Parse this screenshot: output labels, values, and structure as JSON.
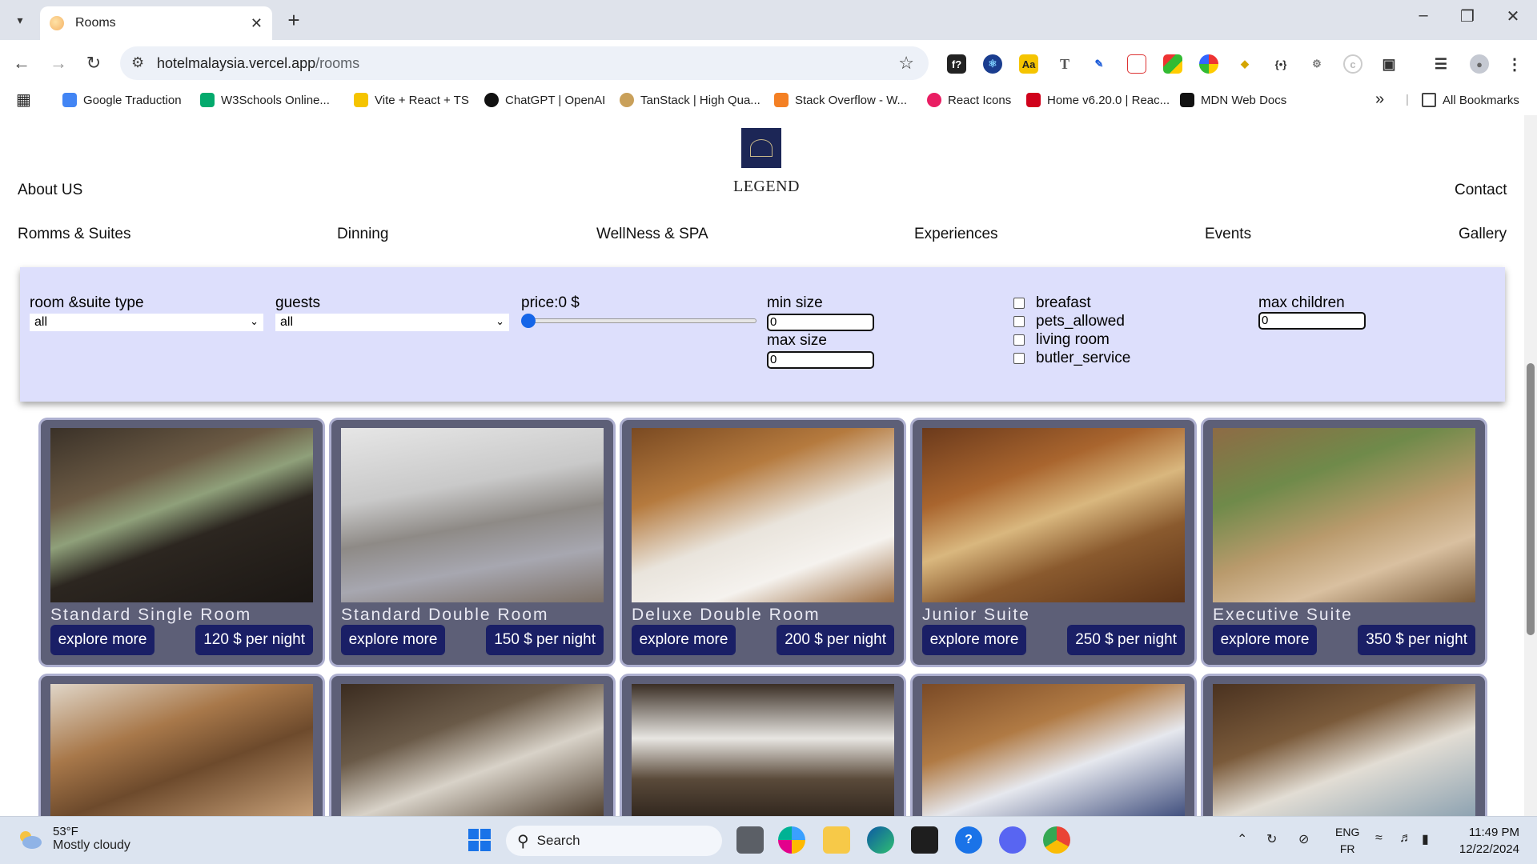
{
  "browser": {
    "tab_title": "Rooms",
    "url_host": "hotelmalaysia.vercel.app",
    "url_path": "/rooms",
    "bookmarks": [
      "Google Traduction",
      "W3Schools Online...",
      "Vite + React + TS",
      "ChatGPT | OpenAI",
      "TanStack | High Qua...",
      "Stack Overflow - W...",
      "React Icons",
      "Home v6.20.0 | Reac...",
      "MDN Web Docs"
    ],
    "all_bookmarks": "All Bookmarks",
    "extension_labels": {
      "f": "f?",
      "aa": "Aa",
      "t": "T"
    }
  },
  "site": {
    "brand": "LEGEND",
    "top_left_link": "About US",
    "top_right_link": "Contact",
    "nav": [
      "Romms & Suites",
      "Dinning",
      "WellNess & SPA",
      "Experiences",
      "Events",
      "Gallery"
    ]
  },
  "filters": {
    "room_type_label": "room &suite type",
    "room_type_value": "all",
    "guests_label": "guests",
    "guests_value": "all",
    "price_label": "price:0 $",
    "price_fraction": 0,
    "min_size_label": "min size",
    "min_size_value": "0",
    "max_size_label": "max size",
    "max_size_value": "0",
    "checkboxes": [
      "breafast",
      "pets_allowed",
      "living room",
      "butler_service"
    ],
    "max_children_label": "max children",
    "max_children_value": "0"
  },
  "rooms": [
    {
      "name": "Standard Single Room",
      "explore": "explore more",
      "price": "120 $ per night"
    },
    {
      "name": "Standard Double Room",
      "explore": "explore more",
      "price": "150 $ per night"
    },
    {
      "name": "Deluxe Double Room",
      "explore": "explore more",
      "price": "200 $ per night"
    },
    {
      "name": "Junior Suite",
      "explore": "explore more",
      "price": "250 $ per night"
    },
    {
      "name": "Executive Suite",
      "explore": "explore more",
      "price": "350 $ per night"
    }
  ],
  "taskbar": {
    "temperature": "53°F",
    "weather": "Mostly cloudy",
    "search_label": "Search",
    "lang_1": "ENG",
    "lang_2": "FR",
    "time": "11:49 PM",
    "date": "12/22/2024"
  },
  "colors": {
    "filter_bg": "#dddffc",
    "card_bg": "#5d5f77",
    "button_bg": "#1a1f66",
    "slider_thumb": "#1565e8"
  }
}
